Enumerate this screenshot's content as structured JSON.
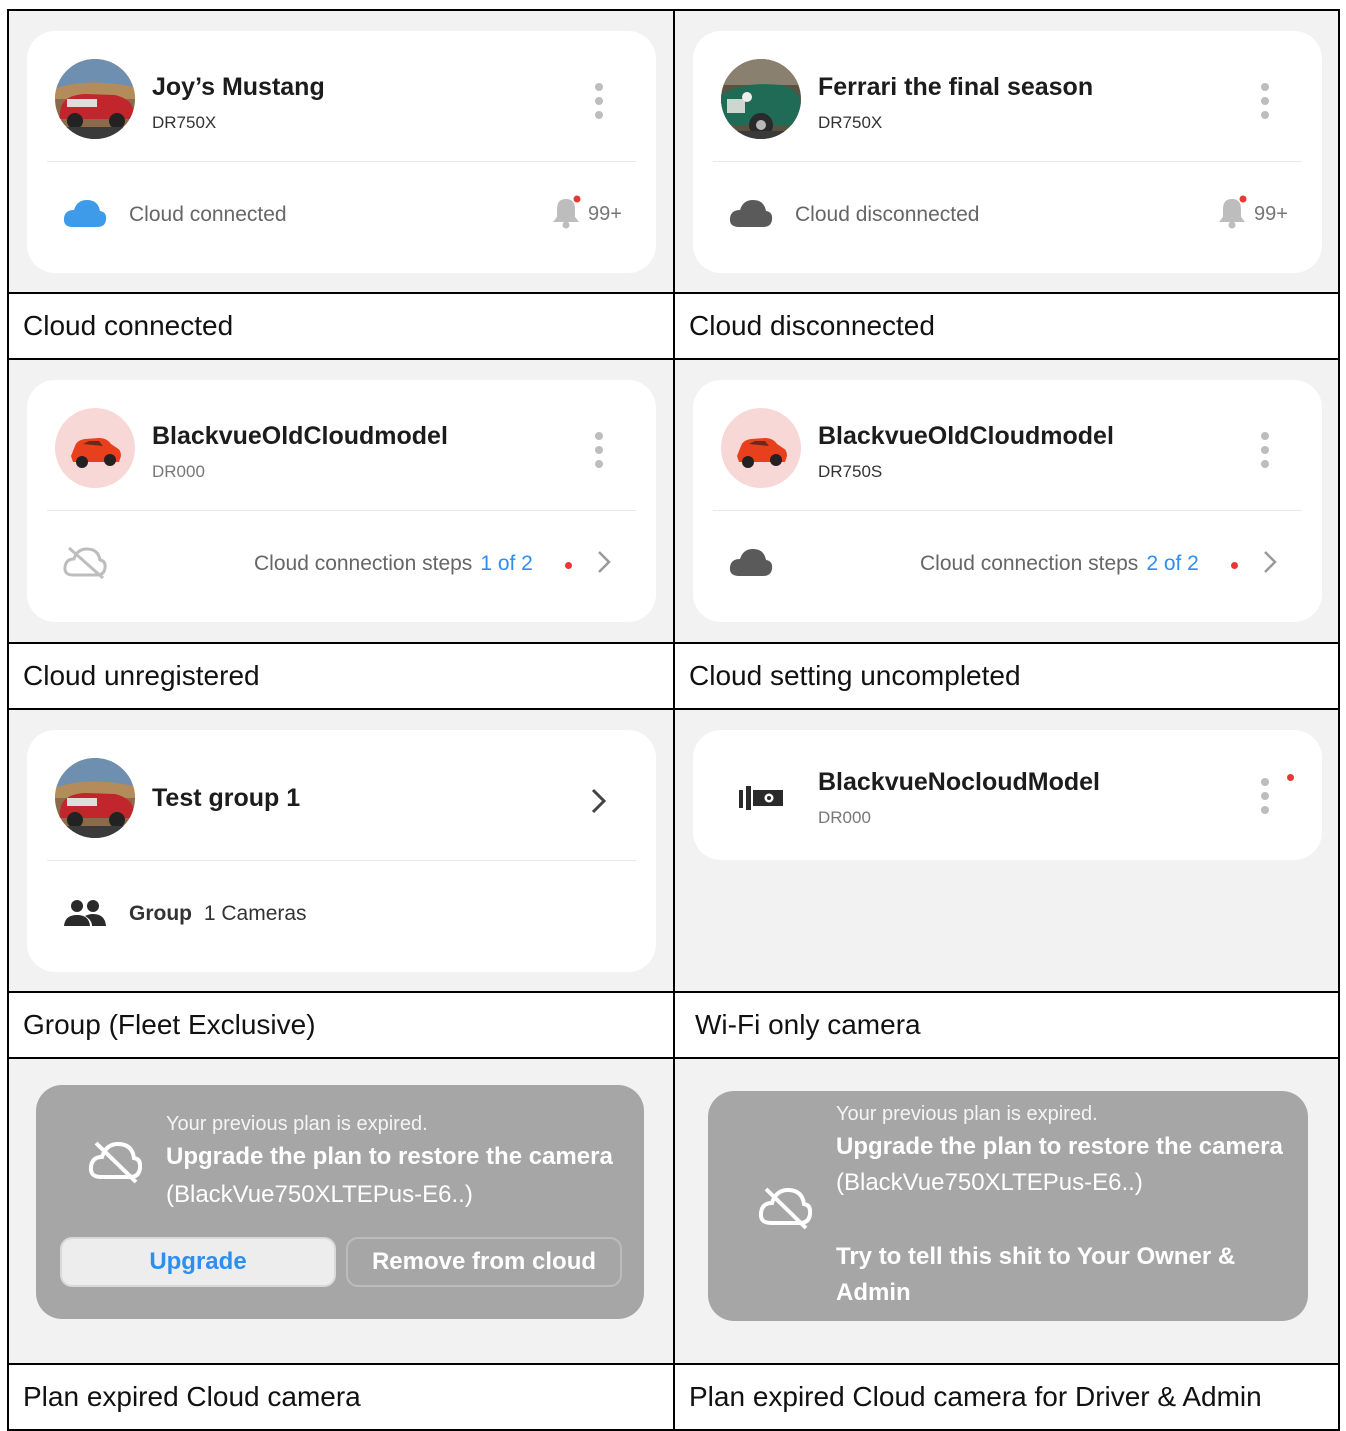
{
  "cells": {
    "connected": {
      "title": "Joy’s Mustang",
      "model": "DR750X",
      "status": "Cloud connected",
      "count": "99+",
      "caption": "Cloud connected"
    },
    "disconnected": {
      "title": "Ferrari the final season",
      "model": "DR750X",
      "status": "Cloud disconnected",
      "count": "99+",
      "caption": "Cloud disconnected"
    },
    "unregistered": {
      "title": "BlackvueOldCloudmodel",
      "model": "DR000",
      "steps_label": "Cloud connection steps",
      "steps_value": "1 of 2",
      "caption": "Cloud unregistered"
    },
    "uncompleted": {
      "title": "BlackvueOldCloudmodel",
      "model": "DR750S",
      "steps_label": "Cloud connection steps",
      "steps_value": "2 of 2",
      "caption": "Cloud setting uncompleted"
    },
    "group": {
      "title": "Test group 1",
      "group_label": "Group",
      "cameras": "1 Cameras",
      "caption": "Group (Fleet Exclusive)"
    },
    "wifi": {
      "title": "BlackvueNocloudModel",
      "model": "DR000",
      "caption": "Wi-Fi only camera"
    },
    "expired": {
      "line1": "Your previous plan is expired.",
      "line2": "Upgrade the plan to restore the camera",
      "line3": "(BlackVue750XLTEPus-E6..)",
      "upgrade": "Upgrade",
      "remove": "Remove from cloud",
      "caption": "Plan expired Cloud camera"
    },
    "expired_driver": {
      "line1": "Your previous plan is expired.",
      "line2": "Upgrade the plan to restore the camera",
      "line3": "(BlackVue750XLTEPus-E6..)",
      "line4": "Try to tell this shit to Your Owner &",
      "line5": "Admin",
      "caption": "Plan expired Cloud camera for Driver & Admin"
    }
  },
  "colors": {
    "accent_blue": "#2e8ef0",
    "cloud_blue": "#3d9be9",
    "alert_red": "#e53935",
    "card_bg": "#ffffff",
    "panel_bg": "#f2f2f2",
    "expired_bg": "#a6a6a6"
  },
  "icons": [
    "more-vertical-icon",
    "cloud-icon",
    "cloud-off-icon",
    "bell-icon",
    "chevron-right-icon",
    "people-icon",
    "dashcam-icon",
    "car-icon"
  ]
}
